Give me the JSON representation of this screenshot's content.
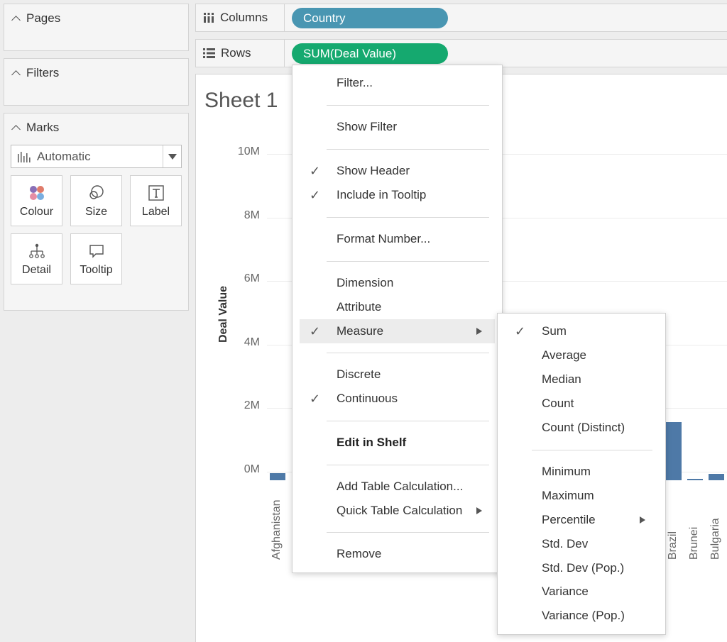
{
  "left_panel": {
    "pages_title": "Pages",
    "filters_title": "Filters",
    "marks_title": "Marks",
    "mark_type": "Automatic",
    "mark_buttons": [
      {
        "label": "Colour",
        "icon": "colour-icon"
      },
      {
        "label": "Size",
        "icon": "size-icon"
      },
      {
        "label": "Label",
        "icon": "label-icon"
      },
      {
        "label": "Detail",
        "icon": "detail-icon"
      },
      {
        "label": "Tooltip",
        "icon": "tooltip-icon"
      }
    ]
  },
  "shelves": {
    "columns_label": "Columns",
    "columns_pill": "Country",
    "columns_pill_color": "#4996b2",
    "rows_label": "Rows",
    "rows_pill": "SUM(Deal Value)",
    "rows_pill_color": "#15a96f"
  },
  "sheet": {
    "title": "Sheet 1"
  },
  "chart_data": {
    "type": "bar",
    "ylabel": "Deal Value",
    "y_ticks": [
      "10M",
      "8M",
      "6M",
      "4M",
      "2M",
      "0M"
    ],
    "ylim": [
      0,
      10000000
    ],
    "categories": [
      "Afghanistan",
      "Brazil",
      "Brunei",
      "Bulgaria"
    ],
    "values": [
      230000,
      1830000,
      40000,
      190000
    ],
    "bar_color": "#4e79a7"
  },
  "context_menu": {
    "items": [
      {
        "label": "Filter...",
        "checked": false
      },
      {
        "label": "Show Filter",
        "checked": false
      },
      {
        "label": "Show Header",
        "checked": true
      },
      {
        "label": "Include in Tooltip",
        "checked": true
      },
      {
        "label": "Format Number...",
        "checked": false
      },
      {
        "label": "Dimension",
        "checked": false
      },
      {
        "label": "Attribute",
        "checked": false
      },
      {
        "label": "Measure",
        "checked": true,
        "submenu": true
      },
      {
        "label": "Discrete",
        "checked": false
      },
      {
        "label": "Continuous",
        "checked": true
      },
      {
        "label": "Edit in Shelf",
        "checked": false
      },
      {
        "label": "Add Table Calculation...",
        "checked": false
      },
      {
        "label": "Quick Table Calculation",
        "checked": false,
        "submenu": true
      },
      {
        "label": "Remove",
        "checked": false
      }
    ],
    "check_glyph": "✓"
  },
  "measure_submenu": {
    "items": [
      {
        "label": "Sum",
        "checked": true
      },
      {
        "label": "Average"
      },
      {
        "label": "Median"
      },
      {
        "label": "Count"
      },
      {
        "label": "Count (Distinct)"
      },
      {
        "label": "Minimum"
      },
      {
        "label": "Maximum"
      },
      {
        "label": "Percentile",
        "submenu": true
      },
      {
        "label": "Std. Dev"
      },
      {
        "label": "Std. Dev (Pop.)"
      },
      {
        "label": "Variance"
      },
      {
        "label": "Variance (Pop.)"
      }
    ]
  }
}
